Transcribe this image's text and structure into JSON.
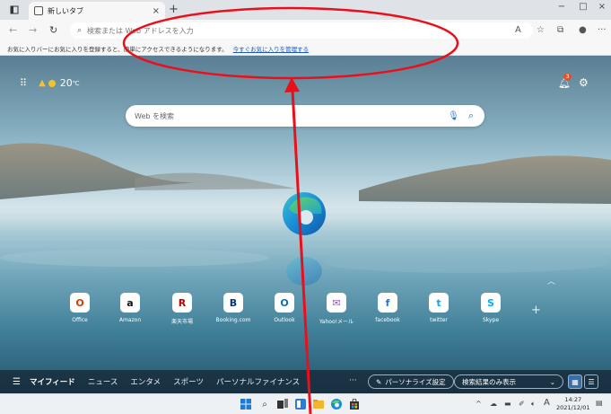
{
  "window": {
    "tab_title": "新しいタブ",
    "tab_close": "×",
    "new_tab": "+",
    "minimize": "−",
    "maximize": "□",
    "close": "×"
  },
  "address_bar": {
    "placeholder": "検索または Web アドレスを入力"
  },
  "favorites_bar": {
    "message": "お気に入りバーにお気に入りを登録すると、簡単にアクセスできるようになります。",
    "link": "今すぐお気に入りを管理する"
  },
  "weather": {
    "temperature": "20",
    "unit": "℃"
  },
  "notifications": {
    "count": "3"
  },
  "search": {
    "placeholder": "Web を検索"
  },
  "quick_links": [
    {
      "label": "Office",
      "glyph": "O",
      "color": "#d83b01"
    },
    {
      "label": "Amazon",
      "glyph": "a",
      "color": "#111111"
    },
    {
      "label": "楽天市場",
      "glyph": "R",
      "color": "#bf0000"
    },
    {
      "label": "Booking.com",
      "glyph": "B",
      "color": "#003580"
    },
    {
      "label": "Outlook",
      "glyph": "O",
      "color": "#0f6cbd"
    },
    {
      "label": "Yahoo!メール",
      "glyph": "✉",
      "color": "#8a5cc2"
    },
    {
      "label": "facebook",
      "glyph": "f",
      "color": "#1877f2"
    },
    {
      "label": "twitter",
      "glyph": "t",
      "color": "#1da1f2"
    },
    {
      "label": "Skype",
      "glyph": "S",
      "color": "#00aff0"
    }
  ],
  "feed": {
    "tabs": [
      "マイフィード",
      "ニュース",
      "エンタメ",
      "スポーツ",
      "パーソナルファイナンス"
    ],
    "more": "···",
    "personalize": "パーソナライズ設定",
    "filter": "検索結果のみ表示"
  },
  "taskbar": {
    "time": "14:27",
    "date": "2021/12/01",
    "ime": "A"
  },
  "colors": {
    "annotation": "#e8101b",
    "accent": "#1a6fd1"
  }
}
